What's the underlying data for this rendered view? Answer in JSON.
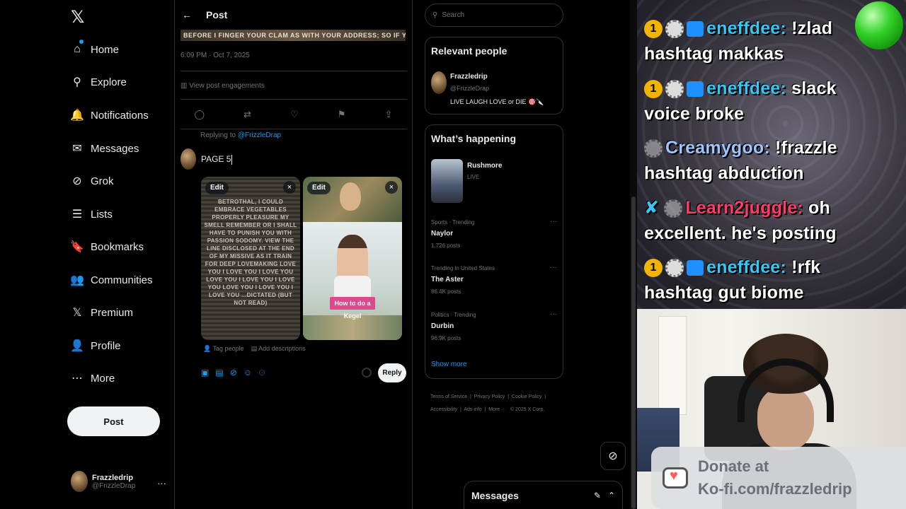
{
  "nav": {
    "logo": "𝕏",
    "items": [
      {
        "label": "Home",
        "icon": "home-icon",
        "glyph": "⌂"
      },
      {
        "label": "Explore",
        "icon": "search-icon",
        "glyph": "⚲"
      },
      {
        "label": "Notifications",
        "icon": "bell-icon",
        "glyph": "🔔"
      },
      {
        "label": "Messages",
        "icon": "envelope-icon",
        "glyph": "✉"
      },
      {
        "label": "Grok",
        "icon": "grok-icon",
        "glyph": "⊘"
      },
      {
        "label": "Lists",
        "icon": "list-icon",
        "glyph": "☰"
      },
      {
        "label": "Bookmarks",
        "icon": "bookmark-icon",
        "glyph": "🔖"
      },
      {
        "label": "Communities",
        "icon": "people-icon",
        "glyph": "👥"
      },
      {
        "label": "Premium",
        "icon": "x-premium-icon",
        "glyph": "𝕏"
      },
      {
        "label": "Profile",
        "icon": "person-icon",
        "glyph": "👤"
      },
      {
        "label": "More",
        "icon": "more-circle-icon",
        "glyph": "⋯"
      }
    ],
    "post_label": "Post",
    "account": {
      "name": "Frazzledrip",
      "handle": "@FrizzleDrap",
      "more": "···"
    }
  },
  "middle": {
    "title": "Post",
    "banner_text": "BEFORE I FINGER YOUR CLAM AS    WITH YOUR ADDRESS; SO IF YOU",
    "timestamp": "6:09 PM · Oct 7, 2025",
    "engagements": "View post engagements",
    "replying_prefix": "Replying to ",
    "replying_handle": "@FrizzleDrap",
    "composer_text": "PAGE 5",
    "media1_text": "BETROTHAL, I COULD EMBRACE VEGETABLES PROPERLY PLEASURE MY SMELL REMEMBER OR I SHALL HAVE TO PUNISH YOU WITH PASSION SODOMY. VIEW THE LINE DISCLOSED AT THE END OF MY MISSIVE AS IT TRAIN FOR DEEP LOVEMAKING LOVE YOU I LOVE YOU I LOVE YOU LOVE YOU I LOVE YOU I LOVE YOU LOVE YOU I LOVE YOU I LOVE YOU ...DICTATED (BUT NOT READ)",
    "media2_label": "How to do a Kegel",
    "edit_label": "Edit",
    "close_glyph": "×",
    "tag_people": "Tag people",
    "add_descriptions": "Add descriptions",
    "reply_label": "Reply"
  },
  "right": {
    "search_placeholder": "Search",
    "relevant_title": "Relevant people",
    "relevant_person": {
      "name": "Frazzledrip",
      "handle": "@FrizzleDrap",
      "bio": "LIVE LAUGH LOVE or DIE 🎯🔪"
    },
    "happening_title": "What’s happening",
    "live_event": {
      "name": "Rushmore",
      "status": "LIVE"
    },
    "trends": [
      {
        "category": "Sports · Trending",
        "name": "Naylor",
        "count": "1,726 posts"
      },
      {
        "category": "Trending in United States",
        "name": "The Aster",
        "count": "86.4K posts"
      },
      {
        "category": "Politics · Trending",
        "name": "Durbin",
        "count": "96.9K posts"
      }
    ],
    "show_more": "Show more",
    "footer": [
      "Terms of Service",
      "Privacy Policy",
      "Cookie Policy",
      "Accessibility",
      "Ads info",
      "More ···",
      "© 2025 X Corp."
    ],
    "messages_title": "Messages"
  },
  "stream": {
    "chat": [
      {
        "user": "eneffdee:",
        "msg": "!zlad",
        "line2": "hashtag makkas"
      },
      {
        "user": "eneffdee:",
        "msg": "slack",
        "line2": "voice broke"
      },
      {
        "user": "Creamygoo:",
        "msg": "!frazzle",
        "line2": "hashtag abduction"
      },
      {
        "user": "Learn2juggle:",
        "msg": "oh",
        "line2": "excellent. he's posting"
      },
      {
        "user": "eneffdee:",
        "msg": "!rfk",
        "line2": "hashtag gut biome"
      }
    ],
    "kofi_line1": "Donate at",
    "kofi_line2": "Ko-fi.com/frazzledrip"
  }
}
